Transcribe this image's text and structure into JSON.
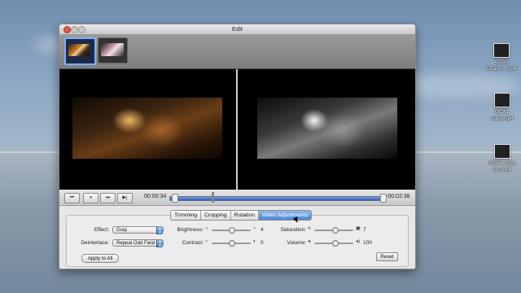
{
  "desktop": {
    "icons": [
      {
        "label": "Good\nCharlo...mp4",
        "icon": "video-file-icon"
      },
      {
        "label": "GOAL\ncopy.mp4",
        "icon": "video-file-icon"
      },
      {
        "label": "GOAL copy\n(1).mp4",
        "icon": "video-file-icon"
      }
    ]
  },
  "window": {
    "title": "Edit"
  },
  "player": {
    "current_time": "00:00:34",
    "remaining_time": "-00:02:38",
    "progress_fraction": 0.18,
    "buttons": {
      "prev": "⏮",
      "play_pause": "⏸",
      "forward": "⏭",
      "next": "▶|"
    }
  },
  "tabs": [
    {
      "label": "Trimming",
      "active": false
    },
    {
      "label": "Cropping",
      "active": false
    },
    {
      "label": "Rotation",
      "active": false
    },
    {
      "label": "Video Adjustments",
      "active": true
    }
  ],
  "adjustments": {
    "effect_label": "Effect:",
    "effect_value": "Gray",
    "deinterlace_label": "Deinterlace:",
    "deinterlace_value": "Repeat Odd Field",
    "brightness_label": "Brightness:",
    "brightness_value": "4",
    "contrast_label": "Contrast:",
    "contrast_value": "0",
    "saturation_label": "Saturation:",
    "saturation_value": "7",
    "volume_label": "Volume:",
    "volume_value": "100"
  },
  "buttons": {
    "apply_all": "Apply to All",
    "reset": "Reset"
  }
}
